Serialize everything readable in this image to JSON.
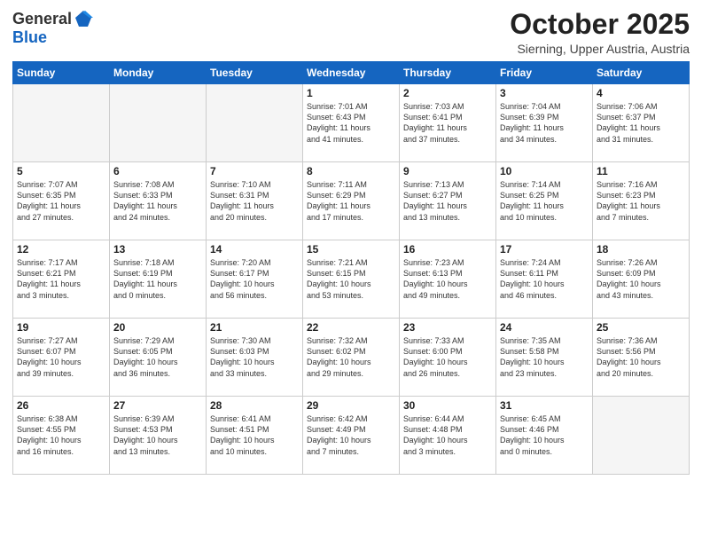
{
  "header": {
    "logo_general": "General",
    "logo_blue": "Blue",
    "month_title": "October 2025",
    "location": "Sierning, Upper Austria, Austria"
  },
  "weekdays": [
    "Sunday",
    "Monday",
    "Tuesday",
    "Wednesday",
    "Thursday",
    "Friday",
    "Saturday"
  ],
  "weeks": [
    [
      {
        "day": "",
        "text": ""
      },
      {
        "day": "",
        "text": ""
      },
      {
        "day": "",
        "text": ""
      },
      {
        "day": "1",
        "text": "Sunrise: 7:01 AM\nSunset: 6:43 PM\nDaylight: 11 hours\nand 41 minutes."
      },
      {
        "day": "2",
        "text": "Sunrise: 7:03 AM\nSunset: 6:41 PM\nDaylight: 11 hours\nand 37 minutes."
      },
      {
        "day": "3",
        "text": "Sunrise: 7:04 AM\nSunset: 6:39 PM\nDaylight: 11 hours\nand 34 minutes."
      },
      {
        "day": "4",
        "text": "Sunrise: 7:06 AM\nSunset: 6:37 PM\nDaylight: 11 hours\nand 31 minutes."
      }
    ],
    [
      {
        "day": "5",
        "text": "Sunrise: 7:07 AM\nSunset: 6:35 PM\nDaylight: 11 hours\nand 27 minutes."
      },
      {
        "day": "6",
        "text": "Sunrise: 7:08 AM\nSunset: 6:33 PM\nDaylight: 11 hours\nand 24 minutes."
      },
      {
        "day": "7",
        "text": "Sunrise: 7:10 AM\nSunset: 6:31 PM\nDaylight: 11 hours\nand 20 minutes."
      },
      {
        "day": "8",
        "text": "Sunrise: 7:11 AM\nSunset: 6:29 PM\nDaylight: 11 hours\nand 17 minutes."
      },
      {
        "day": "9",
        "text": "Sunrise: 7:13 AM\nSunset: 6:27 PM\nDaylight: 11 hours\nand 13 minutes."
      },
      {
        "day": "10",
        "text": "Sunrise: 7:14 AM\nSunset: 6:25 PM\nDaylight: 11 hours\nand 10 minutes."
      },
      {
        "day": "11",
        "text": "Sunrise: 7:16 AM\nSunset: 6:23 PM\nDaylight: 11 hours\nand 7 minutes."
      }
    ],
    [
      {
        "day": "12",
        "text": "Sunrise: 7:17 AM\nSunset: 6:21 PM\nDaylight: 11 hours\nand 3 minutes."
      },
      {
        "day": "13",
        "text": "Sunrise: 7:18 AM\nSunset: 6:19 PM\nDaylight: 11 hours\nand 0 minutes."
      },
      {
        "day": "14",
        "text": "Sunrise: 7:20 AM\nSunset: 6:17 PM\nDaylight: 10 hours\nand 56 minutes."
      },
      {
        "day": "15",
        "text": "Sunrise: 7:21 AM\nSunset: 6:15 PM\nDaylight: 10 hours\nand 53 minutes."
      },
      {
        "day": "16",
        "text": "Sunrise: 7:23 AM\nSunset: 6:13 PM\nDaylight: 10 hours\nand 49 minutes."
      },
      {
        "day": "17",
        "text": "Sunrise: 7:24 AM\nSunset: 6:11 PM\nDaylight: 10 hours\nand 46 minutes."
      },
      {
        "day": "18",
        "text": "Sunrise: 7:26 AM\nSunset: 6:09 PM\nDaylight: 10 hours\nand 43 minutes."
      }
    ],
    [
      {
        "day": "19",
        "text": "Sunrise: 7:27 AM\nSunset: 6:07 PM\nDaylight: 10 hours\nand 39 minutes."
      },
      {
        "day": "20",
        "text": "Sunrise: 7:29 AM\nSunset: 6:05 PM\nDaylight: 10 hours\nand 36 minutes."
      },
      {
        "day": "21",
        "text": "Sunrise: 7:30 AM\nSunset: 6:03 PM\nDaylight: 10 hours\nand 33 minutes."
      },
      {
        "day": "22",
        "text": "Sunrise: 7:32 AM\nSunset: 6:02 PM\nDaylight: 10 hours\nand 29 minutes."
      },
      {
        "day": "23",
        "text": "Sunrise: 7:33 AM\nSunset: 6:00 PM\nDaylight: 10 hours\nand 26 minutes."
      },
      {
        "day": "24",
        "text": "Sunrise: 7:35 AM\nSunset: 5:58 PM\nDaylight: 10 hours\nand 23 minutes."
      },
      {
        "day": "25",
        "text": "Sunrise: 7:36 AM\nSunset: 5:56 PM\nDaylight: 10 hours\nand 20 minutes."
      }
    ],
    [
      {
        "day": "26",
        "text": "Sunrise: 6:38 AM\nSunset: 4:55 PM\nDaylight: 10 hours\nand 16 minutes."
      },
      {
        "day": "27",
        "text": "Sunrise: 6:39 AM\nSunset: 4:53 PM\nDaylight: 10 hours\nand 13 minutes."
      },
      {
        "day": "28",
        "text": "Sunrise: 6:41 AM\nSunset: 4:51 PM\nDaylight: 10 hours\nand 10 minutes."
      },
      {
        "day": "29",
        "text": "Sunrise: 6:42 AM\nSunset: 4:49 PM\nDaylight: 10 hours\nand 7 minutes."
      },
      {
        "day": "30",
        "text": "Sunrise: 6:44 AM\nSunset: 4:48 PM\nDaylight: 10 hours\nand 3 minutes."
      },
      {
        "day": "31",
        "text": "Sunrise: 6:45 AM\nSunset: 4:46 PM\nDaylight: 10 hours\nand 0 minutes."
      },
      {
        "day": "",
        "text": ""
      }
    ]
  ]
}
